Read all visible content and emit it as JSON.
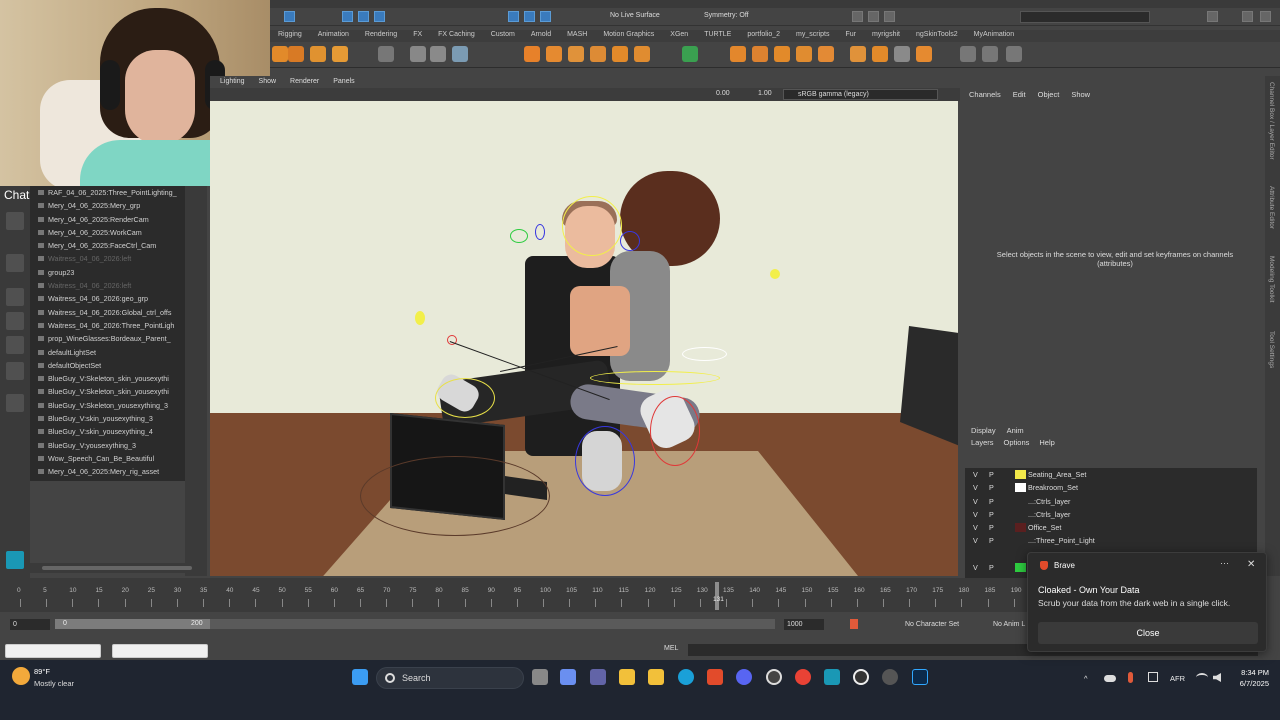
{
  "status_line": {
    "live_surface": "No Live Surface",
    "symmetry": "Symmetry: Off"
  },
  "shelf_tabs": [
    "Rigging",
    "Animation",
    "Rendering",
    "FX",
    "FX Caching",
    "Custom",
    "Arnold",
    "MASH",
    "Motion Graphics",
    "XGen",
    "TURTLE",
    "portfolio_2",
    "my_scripts",
    "Fur",
    "myrigshit",
    "ngSkinTools2",
    "MyAnimation"
  ],
  "webcam_overlay": {
    "chat_label": "Chat"
  },
  "outliner": {
    "items": [
      {
        "label": "RAF_04_06_2025:Three_PointLighting_",
        "dim": false
      },
      {
        "label": "Mery_04_06_2025:Mery_grp",
        "dim": false
      },
      {
        "label": "Mery_04_06_2025:RenderCam",
        "dim": false
      },
      {
        "label": "Mery_04_06_2025:WorkCam",
        "dim": false
      },
      {
        "label": "Mery_04_06_2025:FaceCtrl_Cam",
        "dim": false
      },
      {
        "label": "Waitress_04_06_2026:left",
        "dim": true
      },
      {
        "label": "group23",
        "dim": false
      },
      {
        "label": "Waitress_04_06_2026:left",
        "dim": true
      },
      {
        "label": "Waitress_04_06_2026:geo_grp",
        "dim": false
      },
      {
        "label": "Waitress_04_06_2026:Global_ctrl_offs",
        "dim": false
      },
      {
        "label": "Waitress_04_06_2026:Three_PointLigh",
        "dim": false
      },
      {
        "label": "prop_WineGlasses:Bordeaux_Parent_",
        "dim": false
      },
      {
        "label": "defaultLightSet",
        "dim": false
      },
      {
        "label": "defaultObjectSet",
        "dim": false
      },
      {
        "label": "BlueGuy_V:Skeleton_skin_yousexythi",
        "dim": false
      },
      {
        "label": "BlueGuy_V:Skeleton_skin_yousexythi",
        "dim": false
      },
      {
        "label": "BlueGuy_V:Skeleton_yousexything_3",
        "dim": false
      },
      {
        "label": "BlueGuy_V:skin_yousexything_3",
        "dim": false
      },
      {
        "label": "BlueGuy_V:skin_yousexything_4",
        "dim": false
      },
      {
        "label": "BlueGuy_V:yousexything_3",
        "dim": false
      },
      {
        "label": "Wow_Speech_Can_Be_Beautiful",
        "dim": false
      },
      {
        "label": "Mery_04_06_2025:Mery_rig_asset",
        "dim": false
      }
    ]
  },
  "viewport": {
    "menu": [
      "Lighting",
      "Show",
      "Renderer",
      "Panels"
    ],
    "exposure": "0.00",
    "gamma": "1.00",
    "color_space": "sRGB gamma (legacy)"
  },
  "channel_box": {
    "menu": [
      "Channels",
      "Edit",
      "Object",
      "Show"
    ],
    "empty_message": "Select objects in the scene to view, edit and set keyframes on channels (attributes)"
  },
  "side_tabs": [
    "Channel Box / Layer Editor",
    "Attribute Editor",
    "Modeling Toolkit",
    "Tool Settings"
  ],
  "layer_editor": {
    "tabs": [
      "Display",
      "Anim"
    ],
    "menu": [
      "Layers",
      "Options",
      "Help"
    ],
    "layers": [
      {
        "v": "V",
        "p": "P",
        "color": "#f2e84a",
        "name": "Seating_Area_Set"
      },
      {
        "v": "V",
        "p": "P",
        "color": "#ffffff",
        "name": "Breakroom_Set"
      },
      {
        "v": "V",
        "p": "P",
        "color": "",
        "name": "...:Ctrls_layer"
      },
      {
        "v": "V",
        "p": "P",
        "color": "",
        "name": "...:Ctrls_layer"
      },
      {
        "v": "V",
        "p": "P",
        "color": "#5a1f1f",
        "name": "Office_Set"
      },
      {
        "v": "V",
        "p": "P",
        "color": "",
        "name": "...:Three_Point_Light"
      },
      {
        "v": "",
        "p": "",
        "color": "",
        "name": ""
      },
      {
        "v": "V",
        "p": "P",
        "color": "#2ecc40",
        "name": ""
      }
    ]
  },
  "timeline": {
    "ticks": [
      "0",
      "5",
      "10",
      "15",
      "20",
      "25",
      "30",
      "35",
      "40",
      "45",
      "50",
      "55",
      "60",
      "65",
      "70",
      "75",
      "80",
      "85",
      "90",
      "95",
      "100",
      "105",
      "110",
      "115",
      "120",
      "125",
      "130",
      "135",
      "140",
      "145",
      "150",
      "155",
      "160",
      "165",
      "170",
      "175",
      "180",
      "185",
      "190",
      "195"
    ],
    "current_frame": "131",
    "range_start": "0",
    "anim_start": "0",
    "range_end": "200",
    "anim_end": "1000",
    "character_set": "No Character Set",
    "anim_layer": "No Anim L"
  },
  "command_line": {
    "lang": "MEL"
  },
  "notification": {
    "app": "Brave",
    "title": "Cloaked - Own Your Data",
    "body": "Scrub your data from the dark web in a single click.",
    "button": "Close"
  },
  "taskbar": {
    "weather_temp": "89°F",
    "weather_desc": "Mostly clear",
    "search_label": "Search",
    "lang": "AFR",
    "time": "8:34 PM",
    "date": "6/7/2025"
  }
}
